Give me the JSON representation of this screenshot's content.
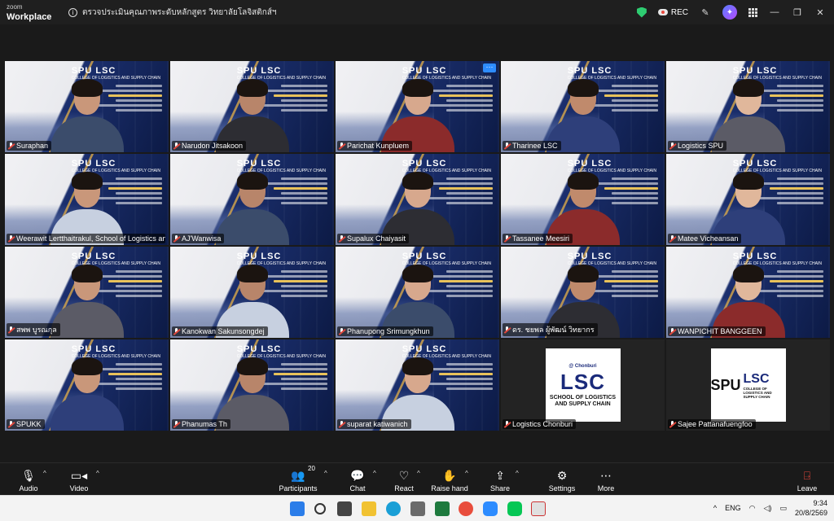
{
  "titlebar": {
    "brand_line1": "zoom",
    "brand_line2": "Workplace",
    "meeting_title": "ตรวจประเมินคุณภาพระดับหลักสูตร วิทยาลัยโลจิสติกส์ฯ",
    "rec_label": "REC"
  },
  "participants": [
    {
      "name": "Suraphan",
      "bg": "slide"
    },
    {
      "name": "Narudon Jitsakoon",
      "bg": "slide"
    },
    {
      "name": "Parichat Kunpluem",
      "bg": "slide"
    },
    {
      "name": "Tharinee LSC",
      "bg": "slide"
    },
    {
      "name": "Logistics SPU",
      "bg": "slide",
      "highlight": true
    },
    {
      "name": "Weerawit Lertthaitrakul, School of Logistics and...",
      "bg": "slide"
    },
    {
      "name": "AJ'Wanwisa",
      "bg": "slide"
    },
    {
      "name": "Supalux Chaiyasit",
      "bg": "slide"
    },
    {
      "name": "Tassanee Meesiri",
      "bg": "slide"
    },
    {
      "name": "Matee Vicheansan",
      "bg": "slide"
    },
    {
      "name": "สพพ บูรณกุล",
      "bg": "slide"
    },
    {
      "name": "Kanokwan Sakunsongdej",
      "bg": "slide"
    },
    {
      "name": "Phanupong Srimungkhun",
      "bg": "slide"
    },
    {
      "name": "ดร. ชยพล ผู้พัฒน์ วิทยากร",
      "bg": "slide"
    },
    {
      "name": "WANPICHIT BANGGEEN",
      "bg": "slide"
    },
    {
      "name": "SPUKK",
      "bg": "slide"
    },
    {
      "name": "Phanumas Th",
      "bg": "slide"
    },
    {
      "name": "suparat katiwanich",
      "bg": "slide"
    },
    {
      "name": "Logistics Chonburi",
      "bg": "logo"
    },
    {
      "name": "Sajee Pattanafuengfoo",
      "bg": "logo2"
    }
  ],
  "tile_slide": {
    "brand": "SPU LSC",
    "brand_sub": "COLLEGE OF LOGISTICS AND SUPPLY CHAIN"
  },
  "logo_chonburi": {
    "side": "@ Chonburi",
    "big": "LSC",
    "sub": "SCHOOL OF LOGISTICS AND SUPPLY CHAIN"
  },
  "logo_spu": {
    "spu": "SPU",
    "lsc": "LSC",
    "sub": "COLLEGE OF LOGISTICS AND SUPPLY CHAIN"
  },
  "toolbar": {
    "audio": "Audio",
    "video": "Video",
    "participants": "Participants",
    "participants_count": "20",
    "chat": "Chat",
    "react": "React",
    "raise_hand": "Raise hand",
    "share": "Share",
    "settings": "Settings",
    "more": "More",
    "leave": "Leave"
  },
  "taskbar": {
    "lang": "ENG",
    "time": "9:34",
    "date": "20/8/2569"
  },
  "colors": {
    "accent": "#2d8cff",
    "active_speaker": "#39d05c",
    "leave": "#e8483c"
  }
}
